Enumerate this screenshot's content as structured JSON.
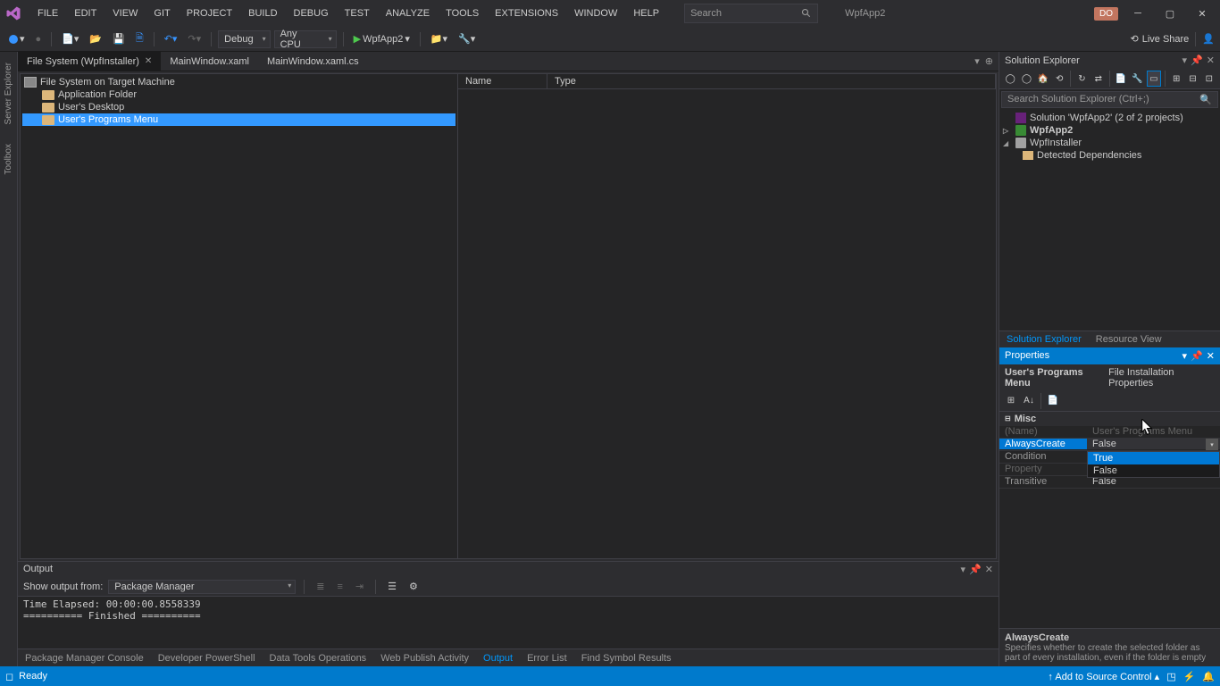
{
  "titlebar": {
    "menu": [
      "FILE",
      "EDIT",
      "VIEW",
      "GIT",
      "PROJECT",
      "BUILD",
      "DEBUG",
      "TEST",
      "ANALYZE",
      "TOOLS",
      "EXTENSIONS",
      "WINDOW",
      "HELP"
    ],
    "search_placeholder": "Search",
    "app_name": "WpfApp2",
    "user_initials": "DO"
  },
  "toolbar": {
    "config": "Debug",
    "platform": "Any CPU",
    "start_target": "WpfApp2",
    "live_share": "Live Share"
  },
  "side_tabs": [
    "Server Explorer",
    "Toolbox"
  ],
  "doc_tabs": [
    {
      "label": "File System (WpfInstaller)",
      "active": true,
      "closable": true
    },
    {
      "label": "MainWindow.xaml",
      "active": false,
      "closable": false
    },
    {
      "label": "MainWindow.xaml.cs",
      "active": false,
      "closable": false
    }
  ],
  "fs_editor": {
    "root": "File System on Target Machine",
    "folders": [
      {
        "label": "Application Folder",
        "selected": false
      },
      {
        "label": "User's Desktop",
        "selected": false
      },
      {
        "label": "User's Programs Menu",
        "selected": true
      }
    ],
    "list_cols": [
      "Name",
      "Type"
    ]
  },
  "solution_explorer": {
    "title": "Solution Explorer",
    "search_placeholder": "Search Solution Explorer (Ctrl+;)",
    "nodes": {
      "solution": "Solution 'WpfApp2' (2 of 2 projects)",
      "proj1": "WpfApp2",
      "proj2": "WpfInstaller",
      "deps": "Detected Dependencies"
    },
    "tabs": [
      "Solution Explorer",
      "Resource View"
    ]
  },
  "properties": {
    "title": "Properties",
    "object": "User's Programs Menu",
    "object_type": "File Installation Properties",
    "category": "Misc",
    "rows": [
      {
        "name": "(Name)",
        "value": "User's Programs Menu",
        "dim": true
      },
      {
        "name": "AlwaysCreate",
        "value": "False",
        "selected": true
      },
      {
        "name": "Condition",
        "value": ""
      },
      {
        "name": "Property",
        "value": "",
        "dim": true
      },
      {
        "name": "Transitive",
        "value": "False"
      }
    ],
    "dropdown": {
      "items": [
        "True",
        "False"
      ],
      "hover": 0
    },
    "desc_name": "AlwaysCreate",
    "desc_text": "Specifies whether to create the selected folder as part of every installation, even if the folder is empty"
  },
  "output": {
    "title": "Output",
    "show_from_label": "Show output from:",
    "show_from_value": "Package Manager",
    "body": "Time Elapsed: 00:00:00.8558339\n========== Finished =========="
  },
  "bottom_tabs": [
    "Package Manager Console",
    "Developer PowerShell",
    "Data Tools Operations",
    "Web Publish Activity",
    "Output",
    "Error List",
    "Find Symbol Results"
  ],
  "bottom_active": 4,
  "status": {
    "ready": "Ready",
    "source_control": "Add to Source Control"
  }
}
